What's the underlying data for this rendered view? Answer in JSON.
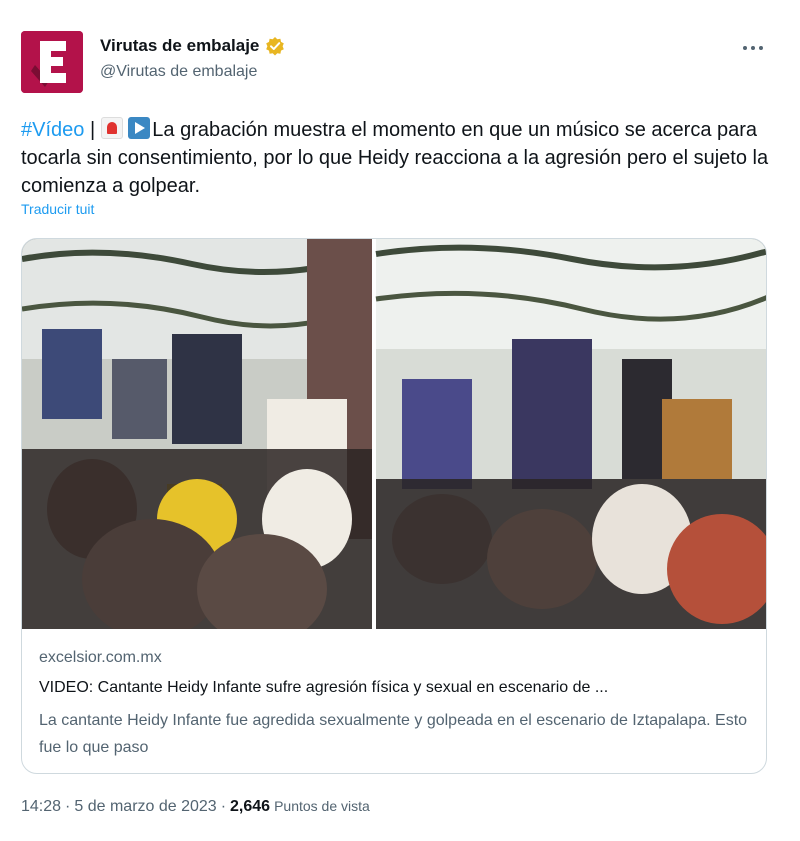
{
  "author": {
    "display_name": "Virutas de embalaje",
    "handle": "@Virutas de embalaje",
    "verified": true,
    "avatar_letter": "E",
    "avatar_color": "#b3124a",
    "verified_color": "#e8b622"
  },
  "more_icon": "more-dots-icon",
  "tweet": {
    "hashtag": "#Vídeo",
    "separator": " | ",
    "emoji_1": "siren-emoji",
    "emoji_2": "play-button-emoji",
    "body": "La grabación muestra el momento en que un músico se acerca para tocarla sin consentimiento, por lo que Heidy reacciona a la agresión pero el sujeto la comienza a golpear.",
    "translate_label": "Traducir tuit"
  },
  "card": {
    "domain": "excelsior.com.mx",
    "title": "VIDEO: Cantante Heidy Infante sufre agresión física y sexual en escenario de ...",
    "description": "La cantante Heidy Infante fue agredida sexualmente y golpeada en el escenario de Iztapalapa. Esto fue lo que paso"
  },
  "meta": {
    "time": "14:28",
    "dot1": "·",
    "date": "5 de marzo de 2023",
    "dot2": "·",
    "views_count": "2,646",
    "views_label": "Puntos de vista"
  },
  "colors": {
    "text": "#0f1419",
    "secondary": "#536471",
    "link": "#1d9bf0",
    "border": "#cfd9de"
  }
}
